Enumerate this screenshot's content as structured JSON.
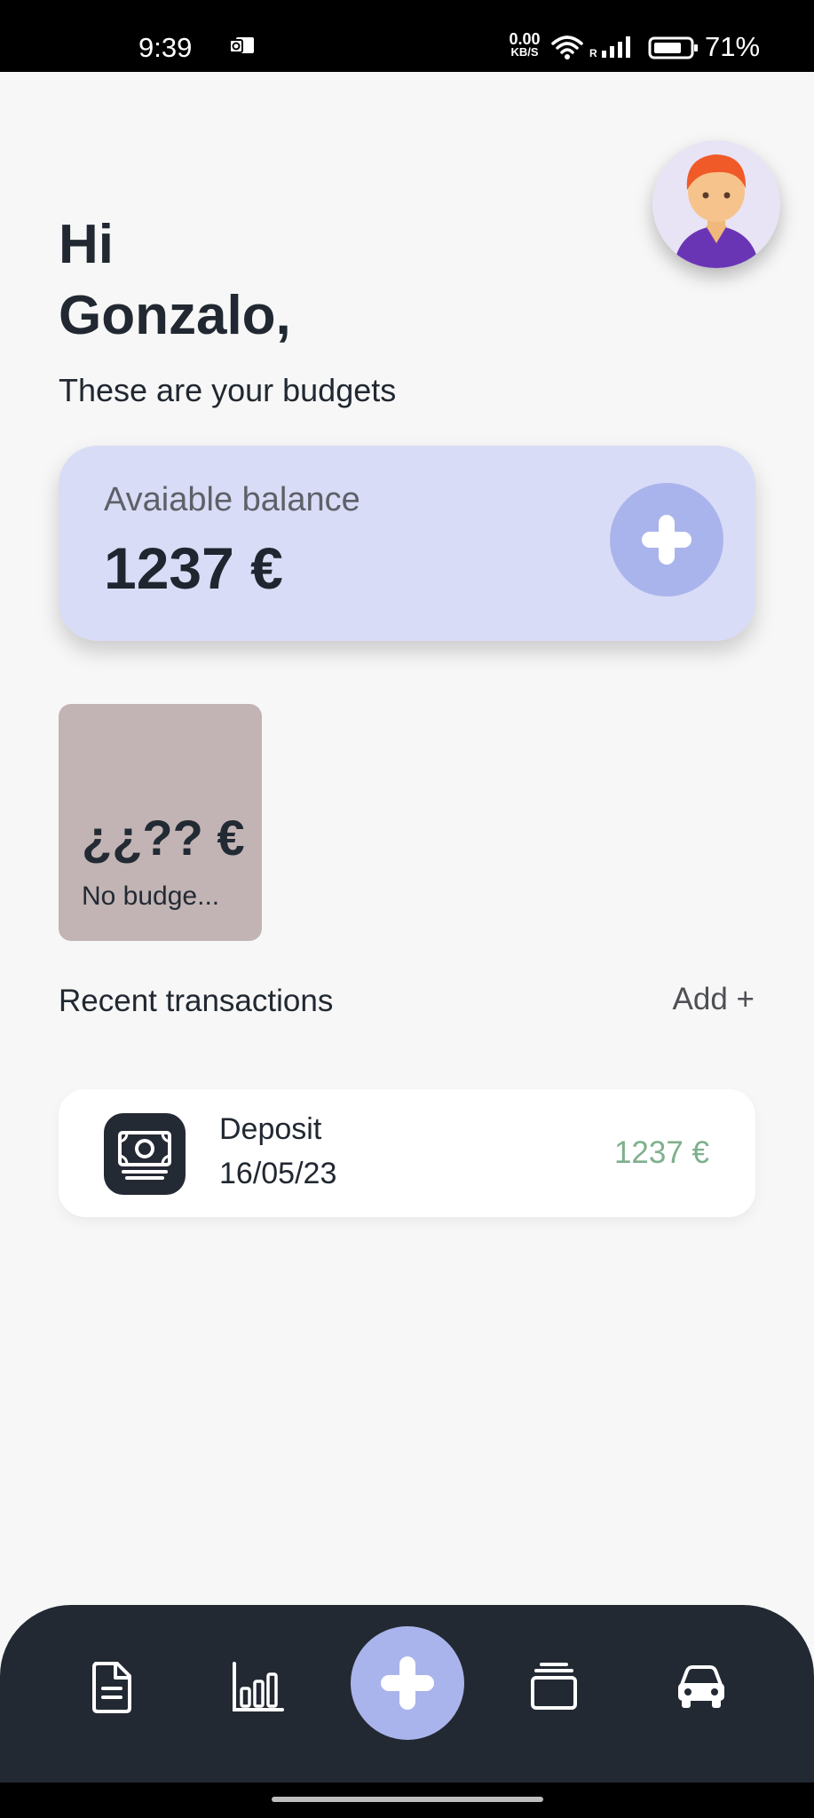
{
  "status_bar": {
    "time": "9:39",
    "net_speed_value": "0.00",
    "net_speed_unit": "KB/S",
    "roaming_indicator": "R",
    "battery_percent": "71%",
    "icons": [
      "outlook-icon",
      "wifi-icon",
      "signal-icon",
      "battery-icon"
    ]
  },
  "header": {
    "greeting_line1": "Hi",
    "greeting_line2": "Gonzalo,",
    "subtitle": "These are your budgets",
    "avatar_icon": "user-avatar"
  },
  "balance_card": {
    "label": "Avaiable balance",
    "amount": "1237 €",
    "add_icon": "plus-icon",
    "background": "#d9dcf6"
  },
  "budgets": [
    {
      "amount": "¿¿?? €",
      "name": "No budge...",
      "color": "#c2b4b4"
    }
  ],
  "recent": {
    "title": "Recent transactions",
    "add_label": "Add +"
  },
  "transactions": [
    {
      "name": "Deposit",
      "date": "16/05/23",
      "amount": "1237 €",
      "icon": "money-icon",
      "amount_color": "#7fb08d"
    }
  ],
  "bottom_nav": {
    "items": [
      "document-icon",
      "bar-chart-icon",
      "plus-icon",
      "wallet-icon",
      "car-icon"
    ],
    "accent": "#aab4ec",
    "background": "#222932"
  }
}
